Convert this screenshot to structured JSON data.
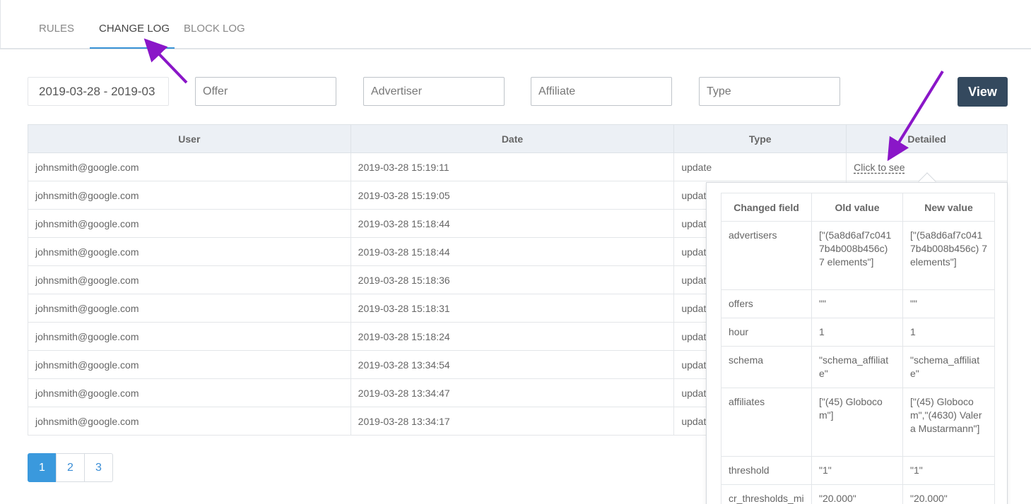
{
  "tabs": [
    {
      "label": "RULES"
    },
    {
      "label": "CHANGE LOG"
    },
    {
      "label": "BLOCK LOG"
    }
  ],
  "filters": {
    "date_range": "2019-03-28 - 2019-03",
    "offer_placeholder": "Offer",
    "advertiser_placeholder": "Advertiser",
    "affiliate_placeholder": "Affiliate",
    "type_placeholder": "Type",
    "view_label": "View"
  },
  "table": {
    "headers": [
      "User",
      "Date",
      "Type",
      "Detailed"
    ],
    "rows": [
      {
        "user": "johnsmith@google.com",
        "date": "2019-03-28 15:19:11",
        "type": "update",
        "detail": "Click to see"
      },
      {
        "user": "johnsmith@google.com",
        "date": "2019-03-28 15:19:05",
        "type": "updat"
      },
      {
        "user": "johnsmith@google.com",
        "date": "2019-03-28 15:18:44",
        "type": "updat"
      },
      {
        "user": "johnsmith@google.com",
        "date": "2019-03-28 15:18:44",
        "type": "updat"
      },
      {
        "user": "johnsmith@google.com",
        "date": "2019-03-28 15:18:36",
        "type": "updat"
      },
      {
        "user": "johnsmith@google.com",
        "date": "2019-03-28 15:18:31",
        "type": "updat"
      },
      {
        "user": "johnsmith@google.com",
        "date": "2019-03-28 15:18:24",
        "type": "updat"
      },
      {
        "user": "johnsmith@google.com",
        "date": "2019-03-28 13:34:54",
        "type": "updat"
      },
      {
        "user": "johnsmith@google.com",
        "date": "2019-03-28 13:34:47",
        "type": "updat"
      },
      {
        "user": "johnsmith@google.com",
        "date": "2019-03-28 13:34:17",
        "type": "updat"
      }
    ]
  },
  "pagination": {
    "pages": [
      "1",
      "2",
      "3"
    ],
    "current": "1"
  },
  "detail_popover": {
    "headers": [
      "Changed field",
      "Old value",
      "New value"
    ],
    "rows": [
      {
        "field": "advertisers",
        "old": "[\"(5a8d6af7c0417b4b008b456c) 7 elements\"]",
        "new": "[\"(5a8d6af7c0417b4b008b456c) 7 elements\"]"
      },
      {
        "field": "offers",
        "old": "\"\"",
        "new": "\"\""
      },
      {
        "field": "hour",
        "old": "1",
        "new": "1"
      },
      {
        "field": "schema",
        "old": "\"schema_affiliate\"",
        "new": "\"schema_affiliate\""
      },
      {
        "field": "affiliates",
        "old": "[\"(45) Globocom\"]",
        "new": "[\"(45) Globocom\",\"(4630) Valera Mustarmann\"]"
      },
      {
        "field": "threshold",
        "old": "\"1\"",
        "new": "\"1\""
      },
      {
        "field": "cr_thresholds_mi",
        "old": "\"20.000\"",
        "new": "\"20.000\""
      }
    ]
  },
  "colors": {
    "accent": "#3a93d6",
    "view_button": "#34495e",
    "annotation_arrow": "#8a16c8"
  }
}
